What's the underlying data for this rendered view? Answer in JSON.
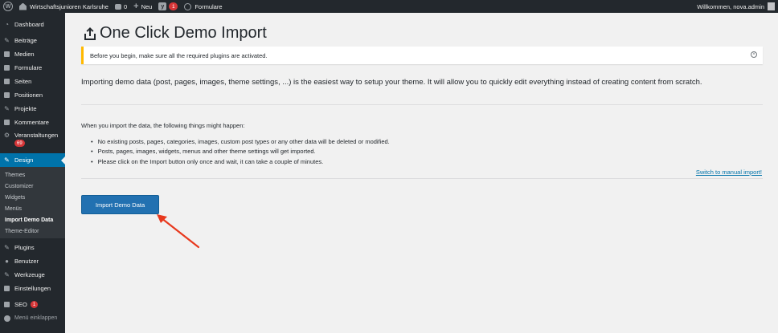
{
  "adminbar": {
    "site_name": "Wirtschaftsjunioren Karlsruhe",
    "comments_count": "0",
    "new_label": "Neu",
    "yoast_badge": "1",
    "formulare_label": "Formulare",
    "welcome": "Willkommen, nova.admin"
  },
  "sidebar": {
    "items_top": [
      {
        "label": "Dashboard",
        "icon": "dashboard-icon"
      },
      {
        "label": "Beiträge",
        "icon": "pin-icon"
      },
      {
        "label": "Medien",
        "icon": "media-icon"
      },
      {
        "label": "Formulare",
        "icon": "forms-icon"
      },
      {
        "label": "Seiten",
        "icon": "pages-icon"
      },
      {
        "label": "Positionen",
        "icon": "positions-icon"
      },
      {
        "label": "Projekte",
        "icon": "projects-icon"
      },
      {
        "label": "Kommentare",
        "icon": "comments-icon"
      }
    ],
    "veranstaltungen": {
      "label": "Veranstaltungen",
      "badge": "69"
    },
    "design": {
      "label": "Design"
    },
    "design_sub": [
      "Themes",
      "Customizer",
      "Widgets",
      "Menüs",
      "Import Demo Data",
      "Theme-Editor"
    ],
    "items_bottom": [
      {
        "label": "Plugins",
        "icon": "plugins-icon"
      },
      {
        "label": "Benutzer",
        "icon": "users-icon"
      },
      {
        "label": "Werkzeuge",
        "icon": "tools-icon"
      },
      {
        "label": "Einstellungen",
        "icon": "settings-icon"
      }
    ],
    "seo": {
      "label": "SEO",
      "badge": "1"
    },
    "collapse": "Menü einklappen"
  },
  "main": {
    "title": "One Click Demo Import",
    "notice": "Before you begin, make sure all the required plugins are activated.",
    "intro": "Importing demo data (post, pages, images, theme settings, ...) is the easiest way to setup your theme. It will allow you to quickly edit everything instead of creating content from scratch.",
    "when_heading": "When you import the data, the following things might happen:",
    "bullets": [
      "No existing posts, pages, categories, images, custom post types or any other data will be deleted or modified.",
      "Posts, pages, images, widgets, menus and other theme settings will get imported.",
      "Please click on the Import button only once and wait, it can take a couple of minutes."
    ],
    "switch_link": "Switch to manual import!",
    "import_button": "Import Demo Data"
  },
  "colors": {
    "adminbar_bg": "#23282d",
    "accent": "#0073aa",
    "notice_border": "#ffb900",
    "arrow": "#e8391e"
  }
}
